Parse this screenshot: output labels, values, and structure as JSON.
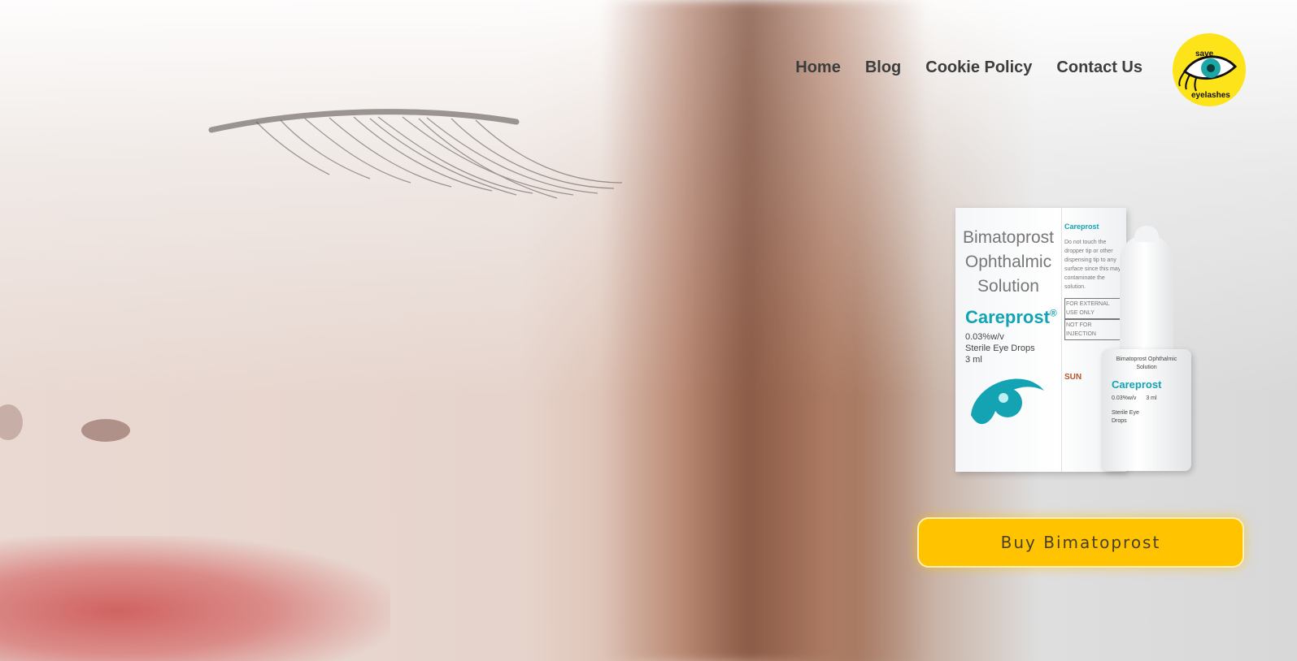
{
  "nav": {
    "items": [
      {
        "label": "Home"
      },
      {
        "label": "Blog"
      },
      {
        "label": "Cookie Policy"
      },
      {
        "label": "Contact Us"
      }
    ]
  },
  "logo": {
    "line1": "save",
    "line2": "eyelashes",
    "icon": "eye-icon",
    "bg_color": "#fde31a"
  },
  "product": {
    "box_title": [
      "Bimatoprost",
      "Ophthalmic",
      "Solution"
    ],
    "brand": "Careprost",
    "registered": "®",
    "strength": "0.03%w/v",
    "form": "Sterile Eye Drops",
    "volume": "3 ml",
    "side_brand": "Careprost",
    "side_text": "Do not touch the dropper tip or other dispensing tip to any surface since this may contaminate the solution.",
    "side_warn1": "FOR EXTERNAL USE ONLY",
    "side_warn2": "NOT FOR INJECTION",
    "maker": "SUN",
    "bottle_title": "Bimatoprost Ophthalmic Solution",
    "bottle_brand": "Careprost",
    "bottle_strength": "0.03%w/v",
    "bottle_volume": "3 ml",
    "bottle_form": "Sterile Eye Drops"
  },
  "cta": {
    "label": "Buy Bimatoprost",
    "color": "#ffc300"
  }
}
